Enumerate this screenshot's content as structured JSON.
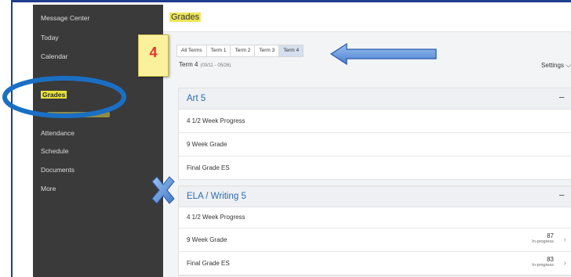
{
  "sidebar": {
    "items": [
      {
        "label": "Message Center"
      },
      {
        "label": "Today"
      },
      {
        "label": "Calendar"
      },
      {
        "label": "Grades"
      },
      {
        "label": "Attendance"
      },
      {
        "label": "Schedule"
      },
      {
        "label": "Documents"
      },
      {
        "label": "More"
      }
    ]
  },
  "page": {
    "title": "Grades"
  },
  "terms": {
    "tabs": [
      "All Terms",
      "Term 1",
      "Term 2",
      "Term 3",
      "Term 4"
    ],
    "selected": "Term 4",
    "current_label": "Term 4",
    "current_dates": "(03/11 - 05/26)"
  },
  "settings_label": "Settings",
  "annotation": {
    "step_number": "4",
    "colors": {
      "highlight": "#e8e23a",
      "arrow": "#6b9ce0",
      "circle": "#1a6fc4",
      "badge_text": "#e8302a"
    }
  },
  "courses": [
    {
      "name": "Art 5",
      "collapse_symbol": "−",
      "rows": [
        {
          "label": "4 1/2 Week Progress"
        },
        {
          "label": "9 Week Grade"
        },
        {
          "label": "Final Grade ES"
        }
      ]
    },
    {
      "name": "ELA / Writing 5",
      "collapse_symbol": "−",
      "rows": [
        {
          "label": "4 1/2 Week Progress"
        },
        {
          "label": "9 Week Grade",
          "score": "87",
          "status": "In-progress"
        },
        {
          "label": "Final Grade ES",
          "score": "83",
          "status": "In-progress"
        }
      ]
    }
  ],
  "icons": {
    "chevron_right": "›",
    "settings_chevron": "⌄"
  }
}
